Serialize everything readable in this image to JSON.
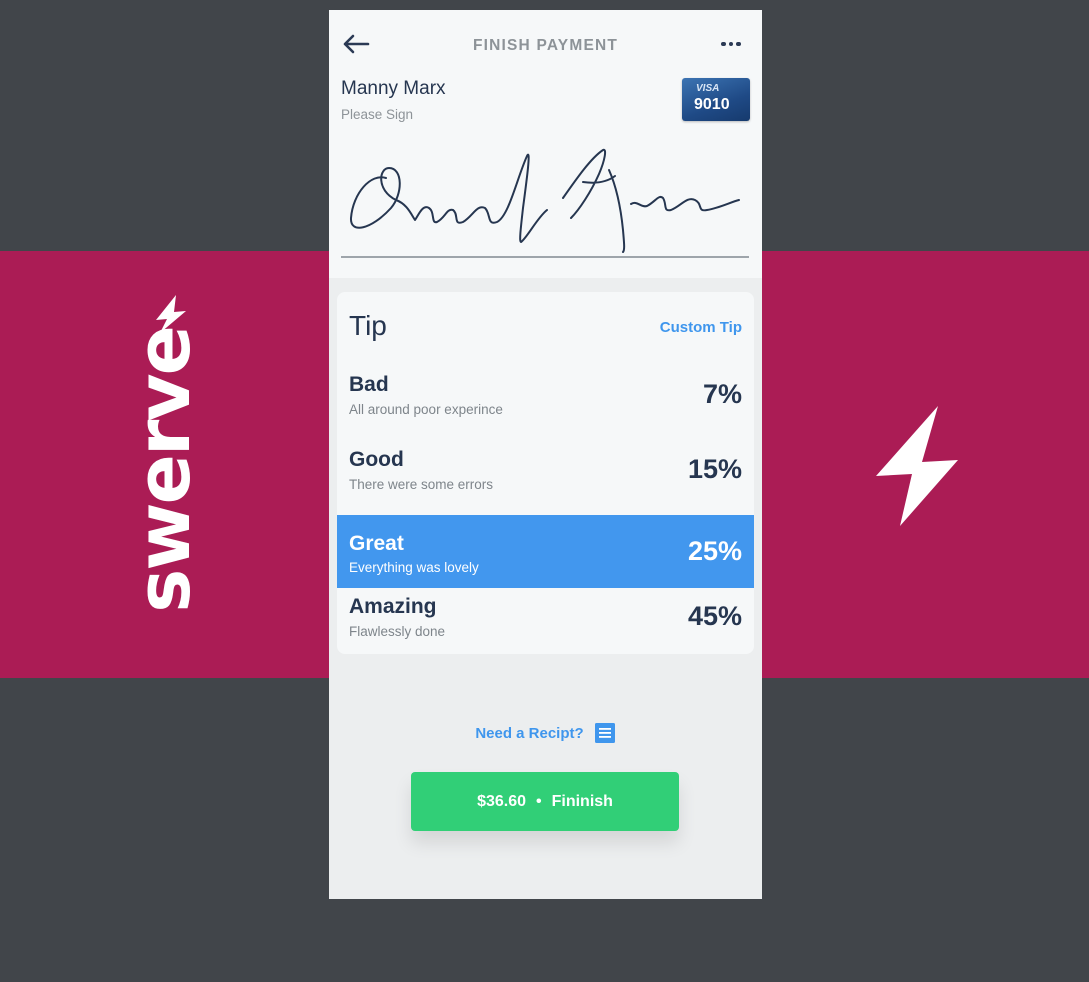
{
  "brand": {
    "wordmark": "swerve",
    "bolt_icon": "lightning-bolt-icon",
    "colors": {
      "band": "#ab1c55",
      "background": "#41454a"
    }
  },
  "header": {
    "title": "FINISH PAYMENT",
    "back_icon": "arrow-left-icon",
    "menu_icon": "more-horizontal-icon"
  },
  "payer": {
    "name": "Manny Marx",
    "prompt": "Please Sign"
  },
  "card": {
    "brand": "VISA",
    "last4": "9010"
  },
  "tip": {
    "title": "Tip",
    "custom_label": "Custom Tip",
    "options": [
      {
        "label": "Bad",
        "description": "All around poor experince",
        "percent": "7%"
      },
      {
        "label": "Good",
        "description": "There were some errors",
        "percent": "15%"
      },
      {
        "label": "Great",
        "description": "Everything was lovely",
        "percent": "25%",
        "selected": true
      },
      {
        "label": "Amazing",
        "description": "Flawlessly done",
        "percent": "45%"
      }
    ],
    "selected_color": "#4297ee"
  },
  "receipt": {
    "label": "Need a Recipt?",
    "icon": "receipt-document-icon"
  },
  "finish": {
    "amount": "$36.60",
    "separator": "•",
    "label": "Fininish",
    "color": "#31cf77"
  }
}
